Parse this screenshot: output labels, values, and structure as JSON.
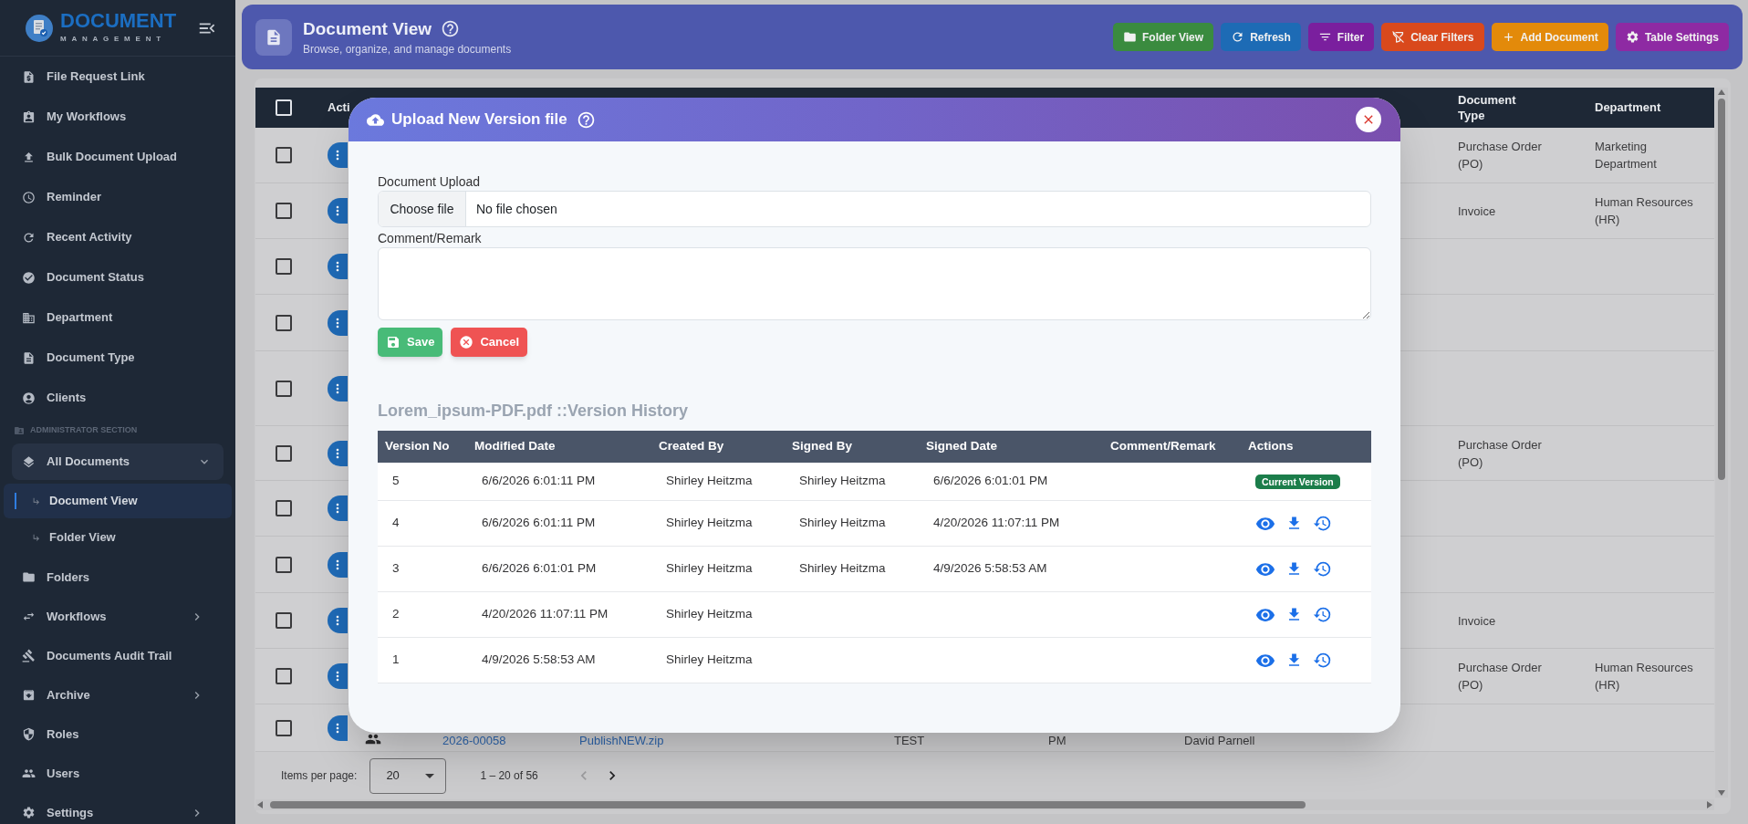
{
  "sidebar": {
    "logo": {
      "title": "DOCUMENT",
      "subtitle": "MANAGEMENT"
    },
    "items": [
      {
        "label": "File Request Link",
        "selected": false
      },
      {
        "label": "My Workflows",
        "selected": false
      },
      {
        "label": "Bulk Document Upload",
        "selected": false
      },
      {
        "label": "Reminder",
        "selected": false
      },
      {
        "label": "Recent Activity",
        "selected": false
      },
      {
        "label": "Document Status",
        "selected": false
      },
      {
        "label": "Department",
        "selected": false
      },
      {
        "label": "Document Type",
        "selected": false
      },
      {
        "label": "Clients",
        "selected": false
      }
    ],
    "section_label": "ADMINISTRATOR SECTION",
    "admin_items": [
      {
        "label": "All Documents",
        "kind": "group",
        "expanded": true,
        "selected": false,
        "children": [
          {
            "label": "Document View",
            "selected": true
          },
          {
            "label": "Folder View",
            "selected": false
          }
        ]
      },
      {
        "label": "Folders",
        "kind": "link",
        "selected": false
      },
      {
        "label": "Workflows",
        "kind": "group",
        "expanded": false,
        "selected": false
      },
      {
        "label": "Documents Audit Trail",
        "kind": "link",
        "selected": false
      },
      {
        "label": "Archive",
        "kind": "group",
        "expanded": false,
        "selected": false
      },
      {
        "label": "Roles",
        "kind": "link",
        "selected": false
      },
      {
        "label": "Users",
        "kind": "link",
        "selected": false
      },
      {
        "label": "Settings",
        "kind": "group",
        "expanded": false,
        "selected": false
      }
    ]
  },
  "header": {
    "title": "Document View",
    "subtitle": "Browse, organize, and manage documents",
    "buttons": [
      {
        "label": "Folder View",
        "color": "#3a8b3f"
      },
      {
        "label": "Refresh",
        "color": "#1d6bb5"
      },
      {
        "label": "Filter",
        "color": "#7a1f9e"
      },
      {
        "label": "Clear Filters",
        "color": "#d9491c"
      },
      {
        "label": "Add Document",
        "color": "#e38a0a"
      },
      {
        "label": "Table Settings",
        "color": "#8e2aa3"
      }
    ]
  },
  "table": {
    "select_all": {
      "checked": false
    },
    "columns": [
      {
        "label": "Acti"
      },
      {
        "label": "Document Type"
      },
      {
        "label": "Department"
      }
    ],
    "rows": [
      {
        "checked": false,
        "document_type": "Purchase Order (PO)",
        "department": "Marketing Department"
      },
      {
        "checked": false,
        "document_type": "Invoice",
        "department": "Human Resources (HR)"
      },
      {
        "checked": false
      },
      {
        "checked": false
      },
      {
        "checked": false
      },
      {
        "checked": false,
        "document_type": "Purchase Order (PO)"
      },
      {
        "checked": false
      },
      {
        "checked": false
      },
      {
        "checked": false,
        "document_type": "Invoice"
      },
      {
        "checked": false,
        "document_type": "Purchase Order (PO)",
        "department": "Human Resources (HR)"
      },
      {
        "checked": false,
        "visible_cells": [
          "2026-00058",
          "PublishNEW.zip",
          "TEST",
          "PM",
          "David Parnell"
        ]
      }
    ]
  },
  "pagination": {
    "label": "Items per page:",
    "page_size": "20",
    "range": "1 – 20 of 56",
    "prev_disabled": true,
    "next_disabled": false
  },
  "modal": {
    "title": "Upload New Version file",
    "fields": [
      {
        "kind": "file",
        "label": "Document Upload",
        "button": "Choose file",
        "status": "No file chosen"
      },
      {
        "kind": "textarea",
        "label": "Comment/Remark"
      }
    ],
    "buttons": [
      {
        "kind": "save",
        "label": "Save"
      },
      {
        "kind": "cancel",
        "label": "Cancel"
      }
    ],
    "history_title": "Lorem_ipsum-PDF.pdf ::Version History",
    "history": {
      "columns": [
        "Version No",
        "Modified Date",
        "Created By",
        "Signed By",
        "Signed Date",
        "Comment/Remark",
        "Actions"
      ],
      "rows": [
        {
          "version": "5",
          "modified_date": "6/6/2026 6:01:11 PM",
          "created_by": "Shirley Heitzma",
          "signed_by": "Shirley Heitzma",
          "signed_date": "6/6/2026 6:01:01 PM",
          "current": true,
          "badge": "Current Version"
        },
        {
          "version": "4",
          "modified_date": "6/6/2026 6:01:11 PM",
          "created_by": "Shirley Heitzma",
          "signed_by": "Shirley Heitzma",
          "signed_date": "4/20/2026 11:07:11 PM",
          "current": false
        },
        {
          "version": "3",
          "modified_date": "6/6/2026 6:01:01 PM",
          "created_by": "Shirley Heitzma",
          "signed_by": "Shirley Heitzma",
          "signed_date": "4/9/2026 5:58:53 AM",
          "current": false
        },
        {
          "version": "2",
          "modified_date": "4/20/2026 11:07:11 PM",
          "created_by": "Shirley Heitzma",
          "current": false
        },
        {
          "version": "1",
          "modified_date": "4/9/2026 5:58:53 AM",
          "created_by": "Shirley Heitzma",
          "current": false
        }
      ]
    }
  }
}
